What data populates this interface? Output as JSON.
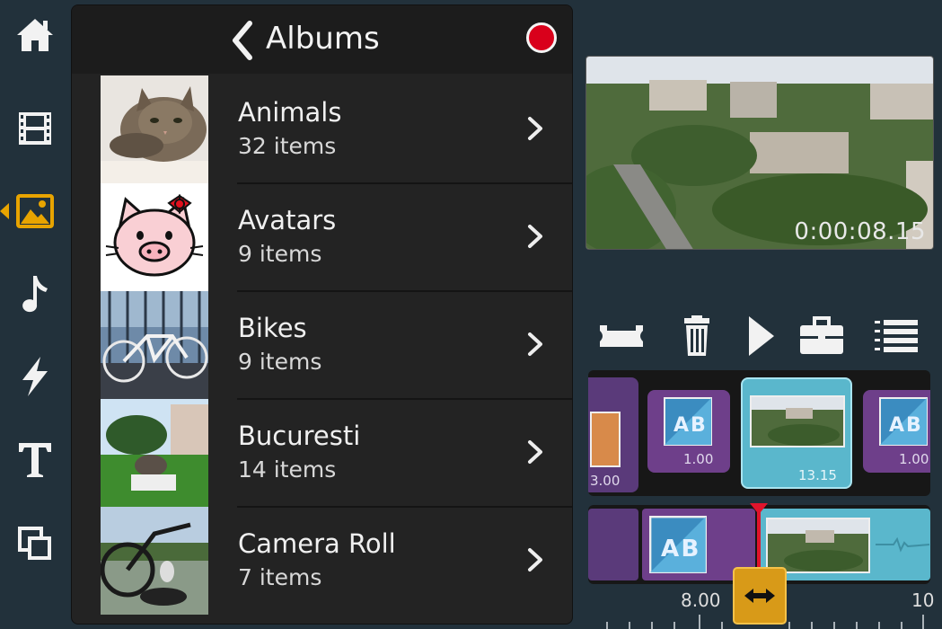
{
  "toolbar": {
    "items": [
      {
        "name": "home",
        "icon": "home-icon"
      },
      {
        "name": "clips",
        "icon": "film-icon"
      },
      {
        "name": "photos",
        "icon": "photo-icon",
        "active": true
      },
      {
        "name": "music",
        "icon": "music-note-icon"
      },
      {
        "name": "effects",
        "icon": "lightning-icon"
      },
      {
        "name": "titles",
        "icon": "text-t-icon"
      },
      {
        "name": "overlays",
        "icon": "layers-icon"
      }
    ],
    "active_color": "#e8a400"
  },
  "albums": {
    "title": "Albums",
    "items": [
      {
        "name": "Animals",
        "count": "32 items"
      },
      {
        "name": "Avatars",
        "count": "9 items"
      },
      {
        "name": "Bikes",
        "count": "9 items"
      },
      {
        "name": "Bucuresti",
        "count": "14 items"
      },
      {
        "name": "Camera Roll",
        "count": "7 items"
      }
    ]
  },
  "preview": {
    "timecode": "0:00:08.15"
  },
  "controls": [
    "split-icon",
    "trash-icon",
    "play-icon",
    "toolbox-icon",
    "list-icon"
  ],
  "timeline": {
    "track1": {
      "clips": [
        {
          "label": "3.00"
        },
        {
          "label": "1.00"
        },
        {
          "label": "13.15"
        },
        {
          "label": "1.00"
        }
      ]
    },
    "ruler": {
      "labels": [
        "8.00",
        "10"
      ]
    }
  },
  "colors": {
    "background": "#22313b",
    "clip_purple": "#6e3f8a",
    "clip_teal": "#5ab7cc",
    "playhead": "#e0142c",
    "handle": "#d89a18"
  }
}
